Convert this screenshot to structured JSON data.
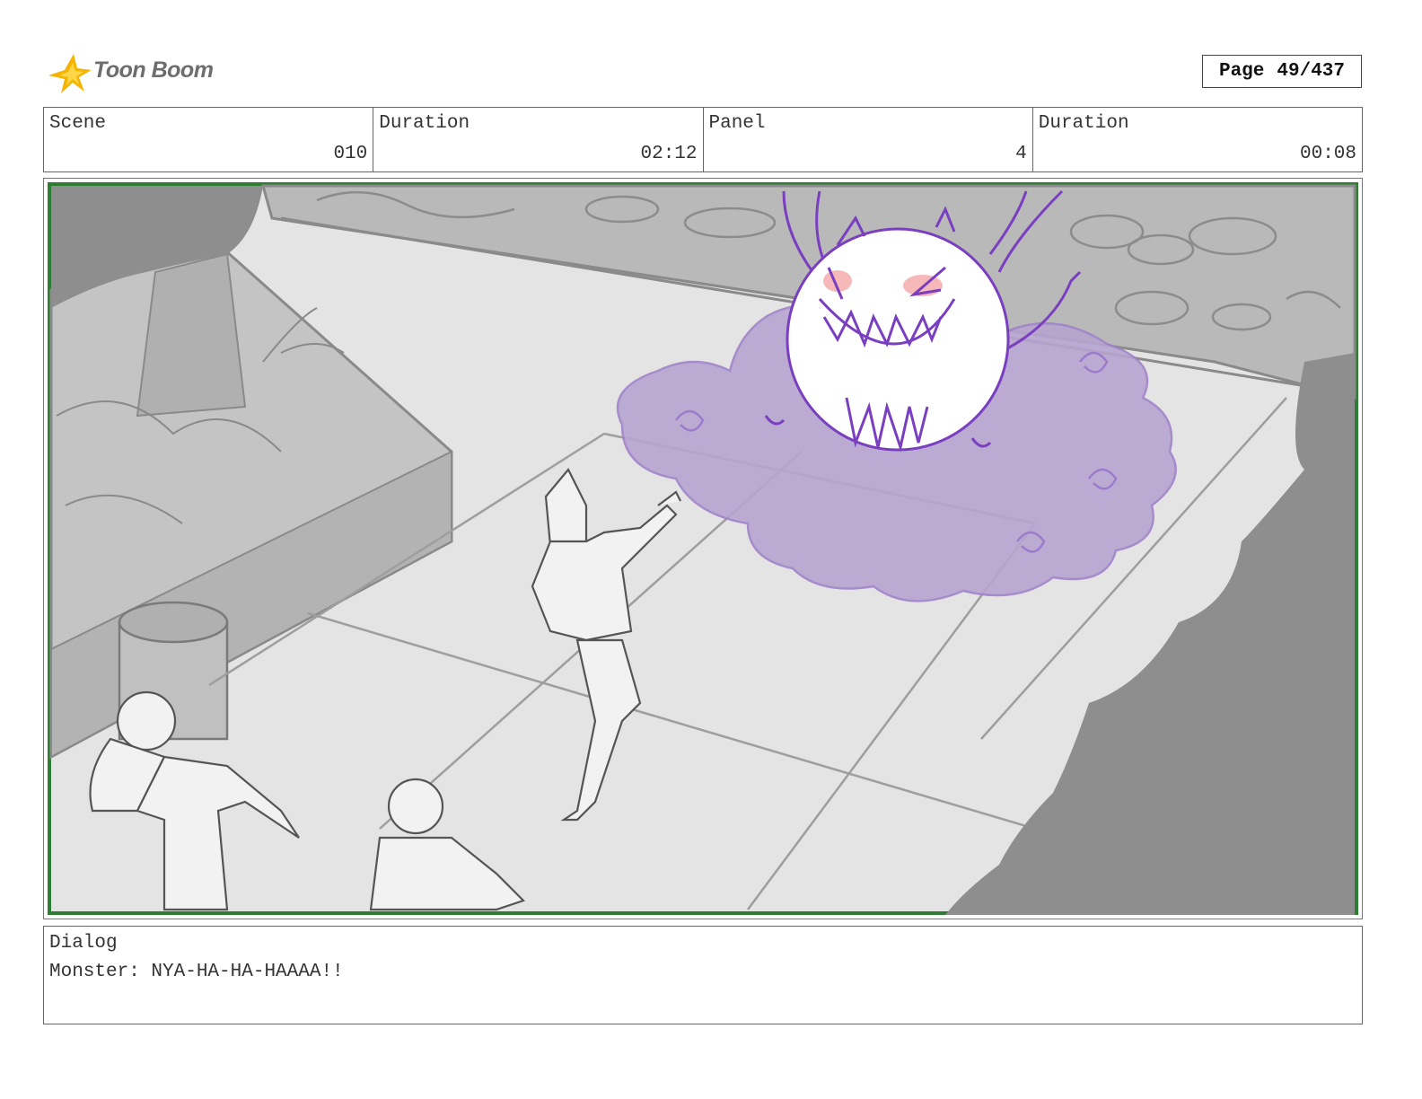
{
  "header": {
    "brand": "Toon Boom",
    "page_label": "Page",
    "page_number": "49/437"
  },
  "info": [
    {
      "label": "Scene",
      "value": "010"
    },
    {
      "label": "Duration",
      "value": "02:12"
    },
    {
      "label": "Panel",
      "value": "4"
    },
    {
      "label": "Duration",
      "value": "00:08"
    }
  ],
  "dialog": {
    "label": "Dialog",
    "text": "Monster: NYA-HA-HA-HAAAA!!"
  },
  "colors": {
    "monster_purple": "#7a3fc0",
    "smoke_purple": "#b7a4cf",
    "frame_green": "#2e7d32"
  },
  "icons": [
    "toon-boom-logo-icon"
  ]
}
